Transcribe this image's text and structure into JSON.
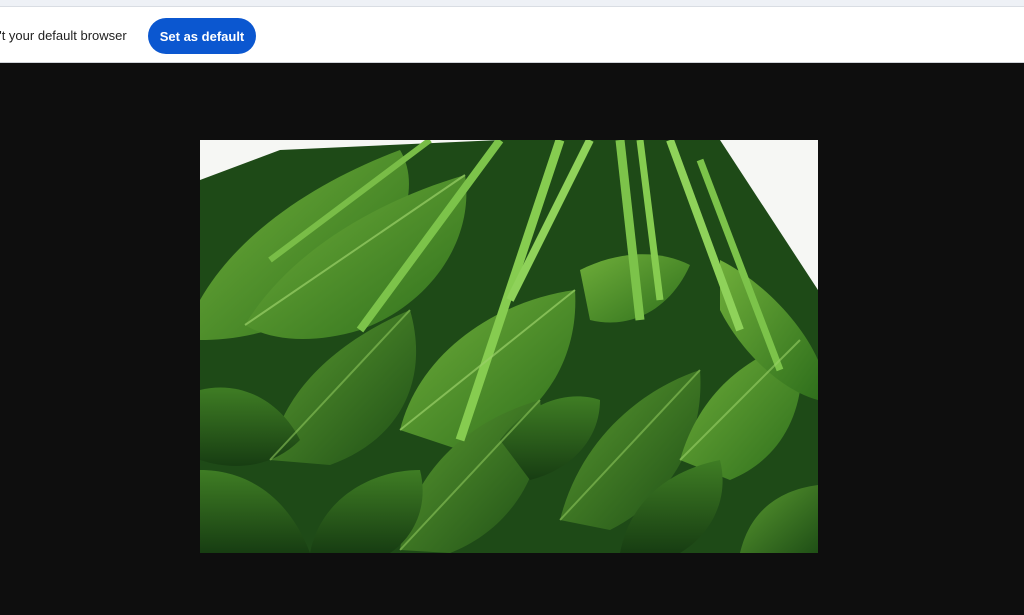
{
  "infobar": {
    "message": "n't your default browser",
    "button_label": "Set as default"
  },
  "colors": {
    "accent": "#0b57d0",
    "viewer_background": "#0e0e0e",
    "infobar_background": "#ffffff"
  },
  "image": {
    "subject_icon": "spinach-photo"
  }
}
